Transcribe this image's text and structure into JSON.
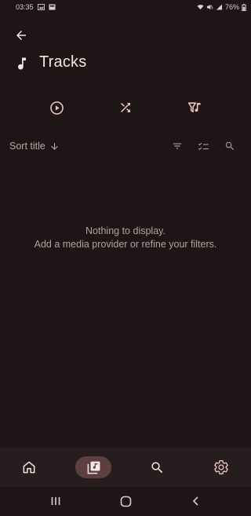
{
  "status_bar": {
    "time": "03:35",
    "battery": "76%",
    "icons": [
      "gallery-icon",
      "cast-icon",
      "wifi-icon",
      "mute-icon",
      "signal-icon",
      "battery-icon"
    ]
  },
  "header": {
    "back_icon": "arrow-back-icon",
    "title": "Tracks",
    "title_icon": "music-note-icon"
  },
  "actions": [
    {
      "name": "play-all-button",
      "icon": "play-circle-icon"
    },
    {
      "name": "shuffle-button",
      "icon": "shuffle-icon"
    },
    {
      "name": "filter-music-button",
      "icon": "music-filter-icon"
    }
  ],
  "sort": {
    "label": "Sort title",
    "direction_icon": "arrow-down-icon"
  },
  "tools": [
    "filter-icon",
    "checklist-icon",
    "search-icon"
  ],
  "empty_state": {
    "line1": "Nothing to display.",
    "line2": "Add a media provider or refine your filters."
  },
  "bottom_nav": {
    "items": [
      {
        "name": "home",
        "icon": "home-icon",
        "active": false
      },
      {
        "name": "library",
        "icon": "music-library-icon",
        "active": true
      },
      {
        "name": "search",
        "icon": "search-icon",
        "active": false
      },
      {
        "name": "settings",
        "icon": "settings-gear-icon",
        "active": false
      }
    ]
  },
  "colors": {
    "background": "#1e1516",
    "nav_background": "#261d1e",
    "active_pill": "#5d3f3f",
    "accent": "#f0c3bd",
    "text_primary": "#f3e6e4",
    "text_secondary": "#b0a2a1"
  }
}
